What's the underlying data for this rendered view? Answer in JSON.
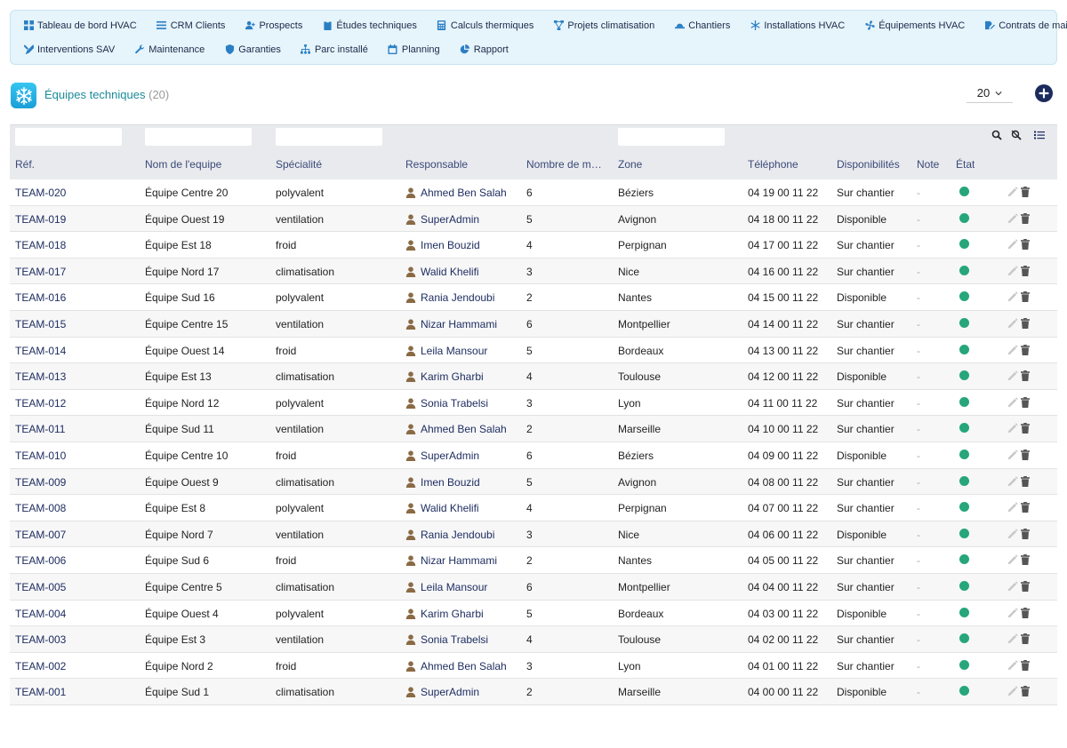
{
  "nav": {
    "row1": [
      {
        "label": "Tableau de bord HVAC",
        "icon": "grid-icon"
      },
      {
        "label": "CRM Clients",
        "icon": "list-icon"
      },
      {
        "label": "Prospects",
        "icon": "user-plus-icon"
      },
      {
        "label": "Études techniques",
        "icon": "clipboard-icon"
      },
      {
        "label": "Calculs thermiques",
        "icon": "calculator-icon"
      },
      {
        "label": "Projets climatisation",
        "icon": "project-diagram-icon"
      },
      {
        "label": "Chantiers",
        "icon": "hard-hat-icon"
      },
      {
        "label": "Installations HVAC",
        "icon": "snowflake-icon"
      },
      {
        "label": "Équipements HVAC",
        "icon": "fan-icon"
      },
      {
        "label": "Contrats de maintenance",
        "icon": "contract-icon"
      }
    ],
    "row2": [
      {
        "label": "Interventions SAV",
        "icon": "tools-icon"
      },
      {
        "label": "Maintenance",
        "icon": "wrench-icon"
      },
      {
        "label": "Garanties",
        "icon": "shield-icon"
      },
      {
        "label": "Parc installé",
        "icon": "sitemap-icon"
      },
      {
        "label": "Planning",
        "icon": "calendar-icon"
      },
      {
        "label": "Rapport",
        "icon": "pie-chart-icon"
      }
    ]
  },
  "header": {
    "title": "Équipes techniques",
    "count": "(20)",
    "per_page": "20"
  },
  "columns": [
    "Réf.",
    "Nom de l'equipe",
    "Spécialité",
    "Responsable",
    "Nombre de m…",
    "Zone",
    "Téléphone",
    "Disponibilités",
    "Note",
    "État"
  ],
  "status_color": "#26a67a",
  "accent": "#1c2b5e",
  "rows": [
    {
      "ref": "TEAM-020",
      "nom": "Équipe Centre 20",
      "spec": "polyvalent",
      "resp": "Ahmed Ben Salah",
      "nb": "6",
      "zone": "Béziers",
      "tel": "04 19 00 11 22",
      "dispo": "Sur chantier",
      "note": "-"
    },
    {
      "ref": "TEAM-019",
      "nom": "Équipe Ouest 19",
      "spec": "ventilation",
      "resp": "SuperAdmin",
      "nb": "5",
      "zone": "Avignon",
      "tel": "04 18 00 11 22",
      "dispo": "Disponible",
      "note": "-"
    },
    {
      "ref": "TEAM-018",
      "nom": "Équipe Est 18",
      "spec": "froid",
      "resp": "Imen Bouzid",
      "nb": "4",
      "zone": "Perpignan",
      "tel": "04 17 00 11 22",
      "dispo": "Sur chantier",
      "note": "-"
    },
    {
      "ref": "TEAM-017",
      "nom": "Équipe Nord 17",
      "spec": "climatisation",
      "resp": "Walid Khelifi",
      "nb": "3",
      "zone": "Nice",
      "tel": "04 16 00 11 22",
      "dispo": "Sur chantier",
      "note": "-"
    },
    {
      "ref": "TEAM-016",
      "nom": "Équipe Sud 16",
      "spec": "polyvalent",
      "resp": "Rania Jendoubi",
      "nb": "2",
      "zone": "Nantes",
      "tel": "04 15 00 11 22",
      "dispo": "Disponible",
      "note": "-"
    },
    {
      "ref": "TEAM-015",
      "nom": "Équipe Centre 15",
      "spec": "ventilation",
      "resp": "Nizar Hammami",
      "nb": "6",
      "zone": "Montpellier",
      "tel": "04 14 00 11 22",
      "dispo": "Sur chantier",
      "note": "-"
    },
    {
      "ref": "TEAM-014",
      "nom": "Équipe Ouest 14",
      "spec": "froid",
      "resp": "Leila Mansour",
      "nb": "5",
      "zone": "Bordeaux",
      "tel": "04 13 00 11 22",
      "dispo": "Sur chantier",
      "note": "-"
    },
    {
      "ref": "TEAM-013",
      "nom": "Équipe Est 13",
      "spec": "climatisation",
      "resp": "Karim Gharbi",
      "nb": "4",
      "zone": "Toulouse",
      "tel": "04 12 00 11 22",
      "dispo": "Disponible",
      "note": "-"
    },
    {
      "ref": "TEAM-012",
      "nom": "Équipe Nord 12",
      "spec": "polyvalent",
      "resp": "Sonia Trabelsi",
      "nb": "3",
      "zone": "Lyon",
      "tel": "04 11 00 11 22",
      "dispo": "Sur chantier",
      "note": "-"
    },
    {
      "ref": "TEAM-011",
      "nom": "Équipe Sud 11",
      "spec": "ventilation",
      "resp": "Ahmed Ben Salah",
      "nb": "2",
      "zone": "Marseille",
      "tel": "04 10 00 11 22",
      "dispo": "Sur chantier",
      "note": "-"
    },
    {
      "ref": "TEAM-010",
      "nom": "Équipe Centre 10",
      "spec": "froid",
      "resp": "SuperAdmin",
      "nb": "6",
      "zone": "Béziers",
      "tel": "04 09 00 11 22",
      "dispo": "Disponible",
      "note": "-"
    },
    {
      "ref": "TEAM-009",
      "nom": "Équipe Ouest 9",
      "spec": "climatisation",
      "resp": "Imen Bouzid",
      "nb": "5",
      "zone": "Avignon",
      "tel": "04 08 00 11 22",
      "dispo": "Sur chantier",
      "note": "-"
    },
    {
      "ref": "TEAM-008",
      "nom": "Équipe Est 8",
      "spec": "polyvalent",
      "resp": "Walid Khelifi",
      "nb": "4",
      "zone": "Perpignan",
      "tel": "04 07 00 11 22",
      "dispo": "Sur chantier",
      "note": "-"
    },
    {
      "ref": "TEAM-007",
      "nom": "Équipe Nord 7",
      "spec": "ventilation",
      "resp": "Rania Jendoubi",
      "nb": "3",
      "zone": "Nice",
      "tel": "04 06 00 11 22",
      "dispo": "Disponible",
      "note": "-"
    },
    {
      "ref": "TEAM-006",
      "nom": "Équipe Sud 6",
      "spec": "froid",
      "resp": "Nizar Hammami",
      "nb": "2",
      "zone": "Nantes",
      "tel": "04 05 00 11 22",
      "dispo": "Sur chantier",
      "note": "-"
    },
    {
      "ref": "TEAM-005",
      "nom": "Équipe Centre 5",
      "spec": "climatisation",
      "resp": "Leila Mansour",
      "nb": "6",
      "zone": "Montpellier",
      "tel": "04 04 00 11 22",
      "dispo": "Sur chantier",
      "note": "-"
    },
    {
      "ref": "TEAM-004",
      "nom": "Équipe Ouest 4",
      "spec": "polyvalent",
      "resp": "Karim Gharbi",
      "nb": "5",
      "zone": "Bordeaux",
      "tel": "04 03 00 11 22",
      "dispo": "Disponible",
      "note": "-"
    },
    {
      "ref": "TEAM-003",
      "nom": "Équipe Est 3",
      "spec": "ventilation",
      "resp": "Sonia Trabelsi",
      "nb": "4",
      "zone": "Toulouse",
      "tel": "04 02 00 11 22",
      "dispo": "Sur chantier",
      "note": "-"
    },
    {
      "ref": "TEAM-002",
      "nom": "Équipe Nord 2",
      "spec": "froid",
      "resp": "Ahmed Ben Salah",
      "nb": "3",
      "zone": "Lyon",
      "tel": "04 01 00 11 22",
      "dispo": "Sur chantier",
      "note": "-"
    },
    {
      "ref": "TEAM-001",
      "nom": "Équipe Sud 1",
      "spec": "climatisation",
      "resp": "SuperAdmin",
      "nb": "2",
      "zone": "Marseille",
      "tel": "04 00 00 11 22",
      "dispo": "Disponible",
      "note": "-"
    }
  ]
}
